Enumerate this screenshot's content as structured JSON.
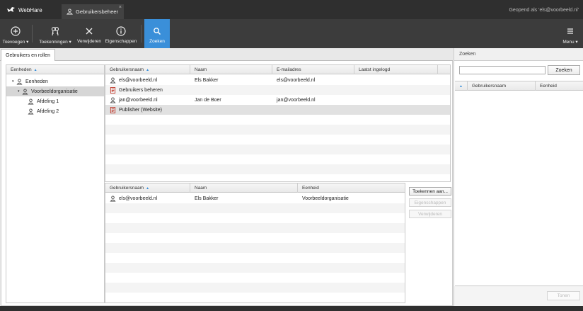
{
  "topbar": {
    "app_name": "WebHare",
    "tab_label": "Gebruikersbeheer",
    "tab_close": "×",
    "user_info": "Geopend als 'els@voorbeeld.nl'"
  },
  "toolbar": {
    "add_label": "Toevoegen ▾",
    "grants_label": "Toekenningen ▾",
    "delete_label": "Verwijderen",
    "properties_label": "Eigenschappen",
    "search_label": "Zoeken",
    "menu_label": "Menu ▾"
  },
  "tabs": {
    "users_roles": "Gebruikers en rollen"
  },
  "tree": {
    "header": "Eenheden",
    "sort_indicator": "▲",
    "items": [
      {
        "label": "Eenheden",
        "expander": "▾"
      },
      {
        "label": "Voorbeeldorganisatie",
        "expander": "▾"
      },
      {
        "label": "Afdeling 1"
      },
      {
        "label": "Afdeling 2"
      }
    ]
  },
  "users_grid": {
    "columns": [
      "Gebruikersnaam",
      "Naam",
      "E-mailadres",
      "Laatst ingelogd"
    ],
    "sort_indicator": "▲",
    "rows": [
      {
        "type": "user",
        "username": "els@voorbeeld.nl",
        "name": "Els Bakker",
        "email": "els@voorbeeld.nl",
        "last_login": ""
      },
      {
        "type": "role",
        "username": "Gebruikers beheren",
        "name": "",
        "email": "",
        "last_login": ""
      },
      {
        "type": "user",
        "username": "jan@voorbeeld.nl",
        "name": "Jan de Boer",
        "email": "jan@voorbeeld.nl",
        "last_login": ""
      },
      {
        "type": "role",
        "username": "Publisher (Website)",
        "name": "",
        "email": "",
        "last_login": ""
      }
    ]
  },
  "grants_grid": {
    "columns": [
      "Gebruikersnaam",
      "Naam",
      "Eenheid"
    ],
    "sort_indicator": "▲",
    "rows": [
      {
        "username": "els@voorbeeld.nl",
        "name": "Els Bakker",
        "unit": "Voorbeeldorganisatie"
      }
    ]
  },
  "grant_actions": {
    "assign": "Toekennen aan...",
    "properties": "Eigenschappen",
    "remove": "Verwijderen"
  },
  "search_panel": {
    "title": "Zoeken",
    "input_value": "",
    "button": "Zoeken",
    "sort_indicator": "▲",
    "columns": [
      "Gebruikersnaam",
      "Eenheid"
    ],
    "show_button": "Tonen"
  },
  "colors": {
    "accent": "#3a8fd9",
    "topbar": "#2f2f2f",
    "toolbar": "#3c3c3c",
    "role_icon": "#c0392b"
  }
}
